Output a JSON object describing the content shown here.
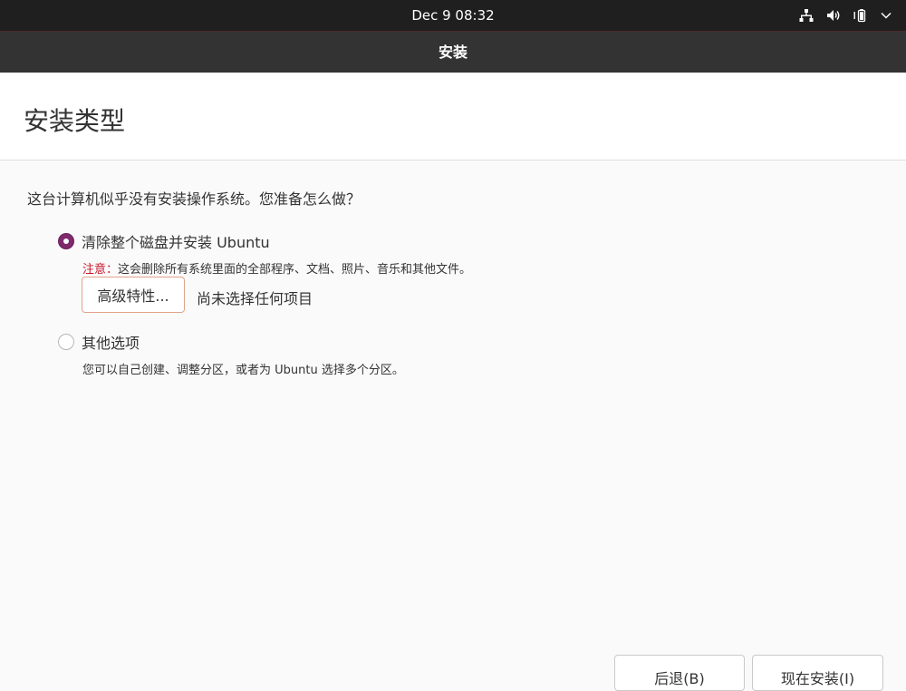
{
  "system_bar": {
    "clock": "Dec 9  08:32",
    "icons": [
      "network-icon",
      "volume-icon",
      "battery-icon",
      "chevron-down-icon"
    ]
  },
  "window": {
    "title": "安装"
  },
  "page": {
    "heading": "安装类型",
    "question": "这台计算机似乎没有安装操作系统。您准备怎么做？",
    "options": [
      {
        "label": "清除整个磁盘并安装 Ubuntu",
        "selected": true,
        "note_prefix": "注意：",
        "note": "这会删除所有系统里面的全部程序、文档、照片、音乐和其他文件。"
      },
      {
        "label": "其他选项",
        "selected": false,
        "note": "您可以自己创建、调整分区，或者为 Ubuntu 选择多个分区。"
      }
    ],
    "advanced_button": "高级特性...",
    "advanced_status": "尚未选择任何项目"
  },
  "buttons": {
    "back": "后退(B)",
    "install": "现在安装(I)"
  },
  "colors": {
    "accent": "#7e2a6c",
    "warning": "#c7162b",
    "focus": "#e2a28a"
  }
}
